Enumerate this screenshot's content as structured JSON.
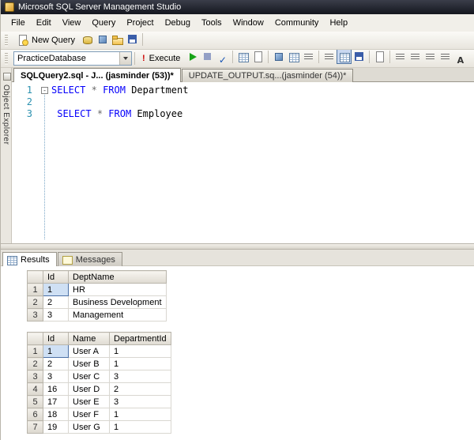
{
  "titlebar": {
    "title": "Microsoft SQL Server Management Studio"
  },
  "menubar": {
    "items": [
      "File",
      "Edit",
      "View",
      "Query",
      "Project",
      "Debug",
      "Tools",
      "Window",
      "Community",
      "Help"
    ]
  },
  "toolbar_standard": {
    "new_query_label": "New Query",
    "icons": [
      {
        "name": "database-engine-query-icon",
        "cls": "i-db"
      },
      {
        "name": "analysis-services-query-icon",
        "cls": "i-cube"
      },
      {
        "name": "open-file-icon",
        "cls": "i-folder"
      },
      {
        "name": "save-icon",
        "cls": "i-disk"
      },
      {
        "sep": true
      }
    ]
  },
  "toolbar_query": {
    "database_value": "PracticeDatabase",
    "execute_glyph": "!",
    "execute_label": "Execute",
    "icons": [
      {
        "name": "debug-icon",
        "cls": "i-play"
      },
      {
        "name": "cancel-query-icon",
        "cls": "i-stop"
      },
      {
        "name": "parse-icon",
        "cls": "i-check",
        "glyph": "✓"
      },
      {
        "sep": true
      },
      {
        "name": "display-estimated-plan-icon",
        "cls": "i-grid"
      },
      {
        "name": "query-options-icon",
        "cls": "i-page"
      },
      {
        "sep": true
      },
      {
        "name": "intellisense-enabled-icon",
        "cls": "i-cube"
      },
      {
        "name": "include-actual-plan-icon",
        "cls": "i-grid"
      },
      {
        "name": "include-client-statistics-icon",
        "cls": "i-text"
      },
      {
        "sep": true
      },
      {
        "name": "results-to-text-icon",
        "cls": "i-text"
      },
      {
        "name": "results-to-grid-icon",
        "cls": "i-grid",
        "state": "selected"
      },
      {
        "name": "results-to-file-icon",
        "cls": "i-disk"
      },
      {
        "sep": true
      },
      {
        "name": "sqlcmd-mode-icon",
        "cls": "i-page"
      },
      {
        "sep": true
      },
      {
        "name": "comment-out-icon",
        "cls": "i-text"
      },
      {
        "name": "uncomment-icon",
        "cls": "i-text"
      },
      {
        "name": "decrease-indent-icon",
        "cls": "i-text"
      },
      {
        "name": "increase-indent-icon",
        "cls": "i-text"
      },
      {
        "name": "font-icon",
        "cls": "i-letter",
        "glyph": "A"
      }
    ]
  },
  "object_explorer": {
    "label": "Object Explorer"
  },
  "document_tabs": [
    {
      "label": "SQLQuery2.sql - J... (jasminder (53))*",
      "active": true
    },
    {
      "label": "UPDATE_OUTPUT.sq...(jasminder (54))*",
      "active": false
    }
  ],
  "editor": {
    "outline_marker": "-",
    "lines": [
      {
        "number": 1,
        "segments": [
          {
            "t": "SELECT",
            "c": "kw"
          },
          {
            "t": " ",
            "c": "tx"
          },
          {
            "t": "*",
            "c": "op"
          },
          {
            "t": " ",
            "c": "tx"
          },
          {
            "t": "FROM",
            "c": "kw"
          },
          {
            "t": " Department",
            "c": "tx"
          }
        ]
      },
      {
        "number": 2,
        "segments": []
      },
      {
        "number": 3,
        "segments": [
          {
            "t": " ",
            "c": "tx"
          },
          {
            "t": "SELECT",
            "c": "kw"
          },
          {
            "t": " ",
            "c": "tx"
          },
          {
            "t": "*",
            "c": "op"
          },
          {
            "t": " ",
            "c": "tx"
          },
          {
            "t": "FROM",
            "c": "kw"
          },
          {
            "t": " Employee",
            "c": "tx"
          }
        ]
      }
    ]
  },
  "results_pane": {
    "tabs": [
      {
        "label": "Results"
      },
      {
        "label": "Messages"
      }
    ]
  },
  "grids": [
    {
      "columns": [
        "Id",
        "DeptName"
      ],
      "rows": [
        [
          "1",
          "HR"
        ],
        [
          "2",
          "Business Development"
        ],
        [
          "3",
          "Management"
        ]
      ],
      "selected_cell": {
        "row": 0,
        "col": 0
      }
    },
    {
      "columns": [
        "Id",
        "Name",
        "DepartmentId"
      ],
      "rows": [
        [
          "1",
          "User A",
          "1"
        ],
        [
          "2",
          "User B",
          "1"
        ],
        [
          "3",
          "User C",
          "3"
        ],
        [
          "16",
          "User D",
          "2"
        ],
        [
          "17",
          "User E",
          "3"
        ],
        [
          "18",
          "User F",
          "1"
        ],
        [
          "19",
          "User G",
          "1"
        ]
      ],
      "selected_cell": {
        "row": 0,
        "col": 0
      }
    }
  ],
  "colors": {
    "keyword": "#0600fb",
    "line_number": "#2b91af",
    "execute_exclamation": "#cc0000",
    "debug_green": "#17a317",
    "selected_cell": "#cfe0f4",
    "title_bar": "#15171f"
  }
}
